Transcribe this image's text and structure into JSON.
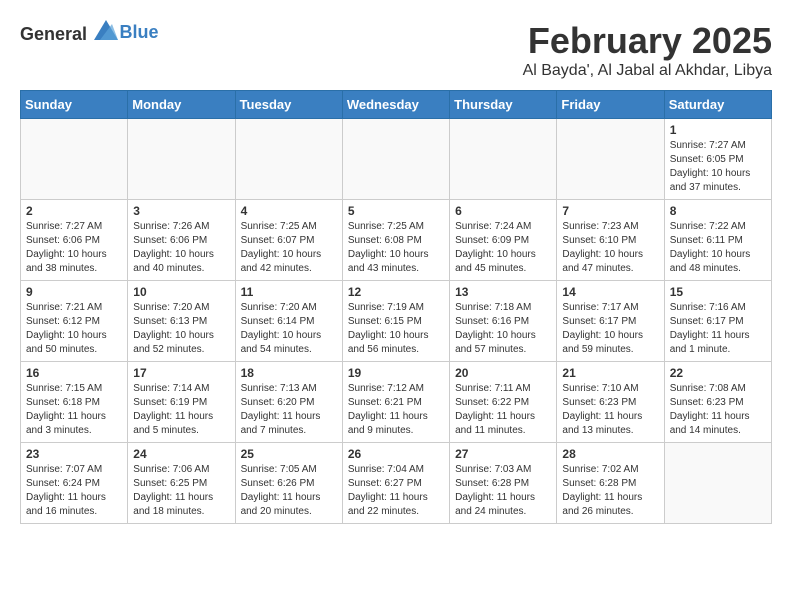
{
  "logo": {
    "general": "General",
    "blue": "Blue"
  },
  "title": "February 2025",
  "subtitle": "Al Bayda', Al Jabal al Akhdar, Libya",
  "days_of_week": [
    "Sunday",
    "Monday",
    "Tuesday",
    "Wednesday",
    "Thursday",
    "Friday",
    "Saturday"
  ],
  "weeks": [
    [
      {
        "day": "",
        "info": ""
      },
      {
        "day": "",
        "info": ""
      },
      {
        "day": "",
        "info": ""
      },
      {
        "day": "",
        "info": ""
      },
      {
        "day": "",
        "info": ""
      },
      {
        "day": "",
        "info": ""
      },
      {
        "day": "1",
        "info": "Sunrise: 7:27 AM\nSunset: 6:05 PM\nDaylight: 10 hours and 37 minutes."
      }
    ],
    [
      {
        "day": "2",
        "info": "Sunrise: 7:27 AM\nSunset: 6:06 PM\nDaylight: 10 hours and 38 minutes."
      },
      {
        "day": "3",
        "info": "Sunrise: 7:26 AM\nSunset: 6:06 PM\nDaylight: 10 hours and 40 minutes."
      },
      {
        "day": "4",
        "info": "Sunrise: 7:25 AM\nSunset: 6:07 PM\nDaylight: 10 hours and 42 minutes."
      },
      {
        "day": "5",
        "info": "Sunrise: 7:25 AM\nSunset: 6:08 PM\nDaylight: 10 hours and 43 minutes."
      },
      {
        "day": "6",
        "info": "Sunrise: 7:24 AM\nSunset: 6:09 PM\nDaylight: 10 hours and 45 minutes."
      },
      {
        "day": "7",
        "info": "Sunrise: 7:23 AM\nSunset: 6:10 PM\nDaylight: 10 hours and 47 minutes."
      },
      {
        "day": "8",
        "info": "Sunrise: 7:22 AM\nSunset: 6:11 PM\nDaylight: 10 hours and 48 minutes."
      }
    ],
    [
      {
        "day": "9",
        "info": "Sunrise: 7:21 AM\nSunset: 6:12 PM\nDaylight: 10 hours and 50 minutes."
      },
      {
        "day": "10",
        "info": "Sunrise: 7:20 AM\nSunset: 6:13 PM\nDaylight: 10 hours and 52 minutes."
      },
      {
        "day": "11",
        "info": "Sunrise: 7:20 AM\nSunset: 6:14 PM\nDaylight: 10 hours and 54 minutes."
      },
      {
        "day": "12",
        "info": "Sunrise: 7:19 AM\nSunset: 6:15 PM\nDaylight: 10 hours and 56 minutes."
      },
      {
        "day": "13",
        "info": "Sunrise: 7:18 AM\nSunset: 6:16 PM\nDaylight: 10 hours and 57 minutes."
      },
      {
        "day": "14",
        "info": "Sunrise: 7:17 AM\nSunset: 6:17 PM\nDaylight: 10 hours and 59 minutes."
      },
      {
        "day": "15",
        "info": "Sunrise: 7:16 AM\nSunset: 6:17 PM\nDaylight: 11 hours and 1 minute."
      }
    ],
    [
      {
        "day": "16",
        "info": "Sunrise: 7:15 AM\nSunset: 6:18 PM\nDaylight: 11 hours and 3 minutes."
      },
      {
        "day": "17",
        "info": "Sunrise: 7:14 AM\nSunset: 6:19 PM\nDaylight: 11 hours and 5 minutes."
      },
      {
        "day": "18",
        "info": "Sunrise: 7:13 AM\nSunset: 6:20 PM\nDaylight: 11 hours and 7 minutes."
      },
      {
        "day": "19",
        "info": "Sunrise: 7:12 AM\nSunset: 6:21 PM\nDaylight: 11 hours and 9 minutes."
      },
      {
        "day": "20",
        "info": "Sunrise: 7:11 AM\nSunset: 6:22 PM\nDaylight: 11 hours and 11 minutes."
      },
      {
        "day": "21",
        "info": "Sunrise: 7:10 AM\nSunset: 6:23 PM\nDaylight: 11 hours and 13 minutes."
      },
      {
        "day": "22",
        "info": "Sunrise: 7:08 AM\nSunset: 6:23 PM\nDaylight: 11 hours and 14 minutes."
      }
    ],
    [
      {
        "day": "23",
        "info": "Sunrise: 7:07 AM\nSunset: 6:24 PM\nDaylight: 11 hours and 16 minutes."
      },
      {
        "day": "24",
        "info": "Sunrise: 7:06 AM\nSunset: 6:25 PM\nDaylight: 11 hours and 18 minutes."
      },
      {
        "day": "25",
        "info": "Sunrise: 7:05 AM\nSunset: 6:26 PM\nDaylight: 11 hours and 20 minutes."
      },
      {
        "day": "26",
        "info": "Sunrise: 7:04 AM\nSunset: 6:27 PM\nDaylight: 11 hours and 22 minutes."
      },
      {
        "day": "27",
        "info": "Sunrise: 7:03 AM\nSunset: 6:28 PM\nDaylight: 11 hours and 24 minutes."
      },
      {
        "day": "28",
        "info": "Sunrise: 7:02 AM\nSunset: 6:28 PM\nDaylight: 11 hours and 26 minutes."
      },
      {
        "day": "",
        "info": ""
      }
    ]
  ]
}
